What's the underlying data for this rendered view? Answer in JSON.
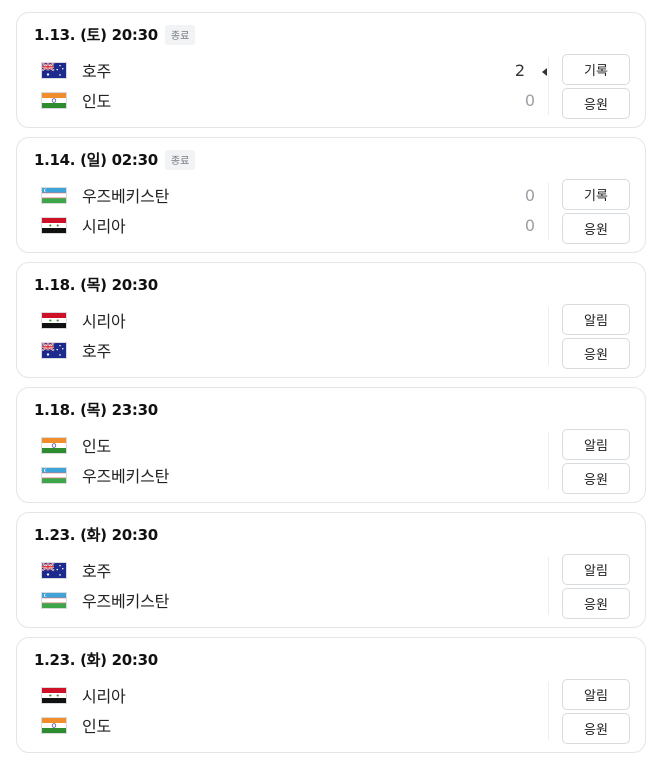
{
  "matches": [
    {
      "date": "1.13. (토) 20:30",
      "status": "종료",
      "team1": {
        "name": "호주",
        "flag": "australia-flag",
        "score": "2",
        "winner": true
      },
      "team2": {
        "name": "인도",
        "flag": "india-flag",
        "score": "0",
        "winner": false
      },
      "button1": "기록",
      "button2": "응원"
    },
    {
      "date": "1.14. (일) 02:30",
      "status": "종료",
      "team1": {
        "name": "우즈베키스탄",
        "flag": "uzbekistan-flag",
        "score": "0",
        "winner": false
      },
      "team2": {
        "name": "시리아",
        "flag": "syria-flag",
        "score": "0",
        "winner": false
      },
      "button1": "기록",
      "button2": "응원"
    },
    {
      "date": "1.18. (목) 20:30",
      "status": "",
      "team1": {
        "name": "시리아",
        "flag": "syria-flag",
        "score": "",
        "winner": false
      },
      "team2": {
        "name": "호주",
        "flag": "australia-flag",
        "score": "",
        "winner": false
      },
      "button1": "알림",
      "button2": "응원"
    },
    {
      "date": "1.18. (목) 23:30",
      "status": "",
      "team1": {
        "name": "인도",
        "flag": "india-flag",
        "score": "",
        "winner": false
      },
      "team2": {
        "name": "우즈베키스탄",
        "flag": "uzbekistan-flag",
        "score": "",
        "winner": false
      },
      "button1": "알림",
      "button2": "응원"
    },
    {
      "date": "1.23. (화) 20:30",
      "status": "",
      "team1": {
        "name": "호주",
        "flag": "australia-flag",
        "score": "",
        "winner": false
      },
      "team2": {
        "name": "우즈베키스탄",
        "flag": "uzbekistan-flag",
        "score": "",
        "winner": false
      },
      "button1": "알림",
      "button2": "응원"
    },
    {
      "date": "1.23. (화) 20:30",
      "status": "",
      "team1": {
        "name": "시리아",
        "flag": "syria-flag",
        "score": "",
        "winner": false
      },
      "team2": {
        "name": "인도",
        "flag": "india-flag",
        "score": "",
        "winner": false
      },
      "button1": "알림",
      "button2": "응원"
    }
  ]
}
